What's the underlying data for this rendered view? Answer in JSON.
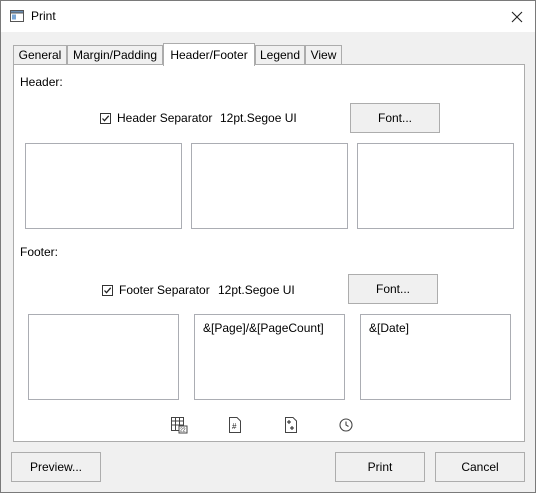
{
  "window": {
    "title": "Print",
    "icon": "printer-window-icon",
    "close_icon": "close-icon"
  },
  "tabs": [
    {
      "label": "General",
      "active": false
    },
    {
      "label": "Margin/Padding",
      "active": false
    },
    {
      "label": "Header/Footer",
      "active": true
    },
    {
      "label": "Legend",
      "active": false
    },
    {
      "label": "View",
      "active": false
    }
  ],
  "header": {
    "section_label": "Header:",
    "separator_label": "Header Separator",
    "separator_checked": true,
    "font_description": "12pt.Segoe UI",
    "font_button": "Font...",
    "left_text": "",
    "center_text": "",
    "right_text": ""
  },
  "footer": {
    "section_label": "Footer:",
    "separator_label": "Footer Separator",
    "separator_checked": true,
    "font_description": "12pt.Segoe UI",
    "font_button": "Font...",
    "left_text": "",
    "center_text": "&[Page]/&[PageCount]",
    "right_text": "&[Date]"
  },
  "insert_tools": [
    "page-count-icon",
    "page-number-icon",
    "add-page-icon",
    "clock-icon"
  ],
  "buttons": {
    "preview": "Preview...",
    "print": "Print",
    "cancel": "Cancel"
  }
}
